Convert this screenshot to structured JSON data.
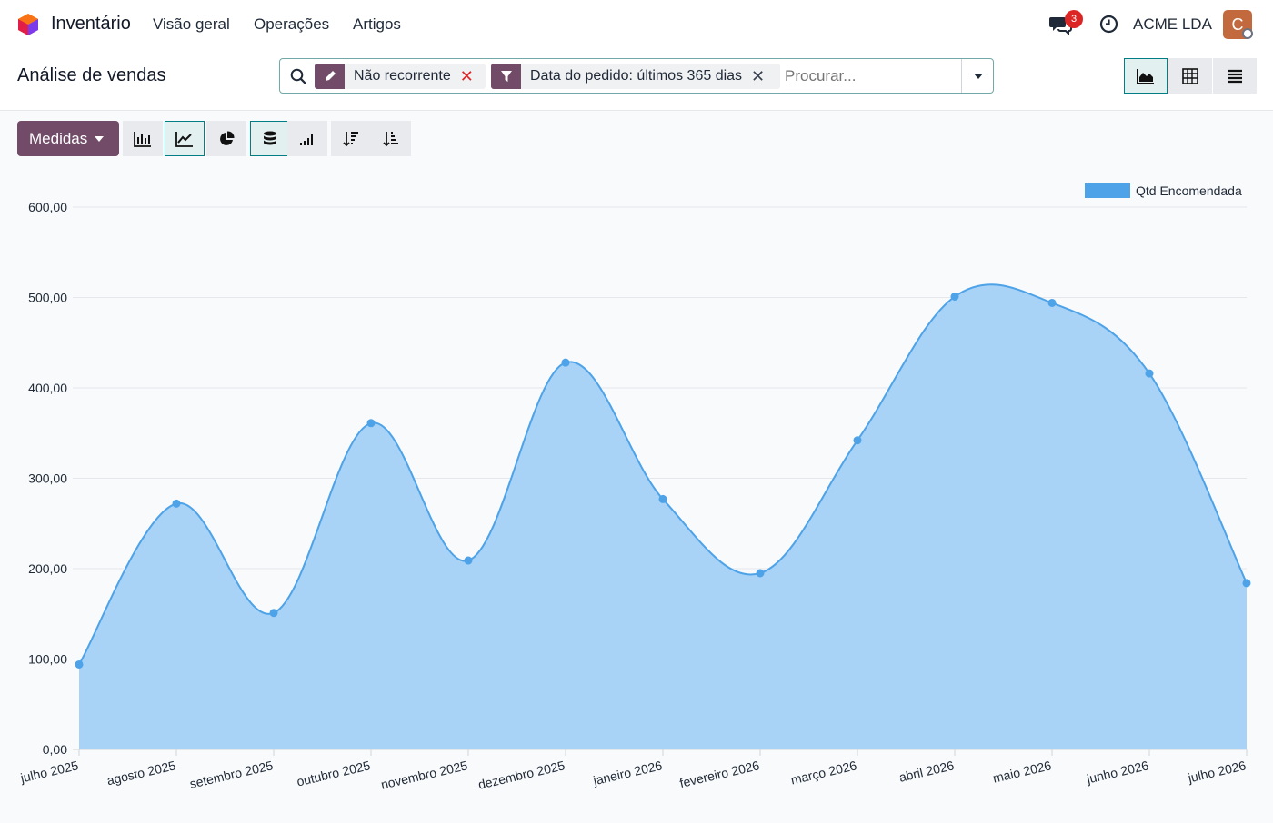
{
  "app": {
    "name": "Inventário",
    "menu": [
      "Visão geral",
      "Operações",
      "Artigos"
    ],
    "notifications_count": "3",
    "company": "ACME LDA",
    "avatar_letter": "C"
  },
  "control": {
    "page_title": "Análise de vendas",
    "facets": [
      {
        "label": "Não recorrente",
        "icon": "pencil-icon"
      },
      {
        "label": "Data do pedido: últimos 365 dias",
        "icon": "filter-icon"
      }
    ],
    "search_placeholder": "Procurar...",
    "views": [
      "graph-view-icon",
      "pivot-view-icon",
      "list-view-icon"
    ]
  },
  "toolbar": {
    "measures_label": "Medidas",
    "buttons": [
      "bar-chart-icon",
      "line-chart-icon",
      "pie-chart-icon",
      "stacked-icon",
      "cumulative-icon",
      "sort-descending-icon",
      "sort-ascending-icon"
    ]
  },
  "colors": {
    "brand": "#714b67",
    "accent": "#017e84",
    "series": "#4ea3e8",
    "series_fill": "#a8d2f6",
    "close_red": "#dc2626"
  },
  "chart_data": {
    "type": "area",
    "categories": [
      "julho 2025",
      "agosto 2025",
      "setembro 2025",
      "outubro 2025",
      "novembro 2025",
      "dezembro 2025",
      "janeiro 2026",
      "fevereiro 2026",
      "março 2026",
      "abril 2026",
      "maio 2026",
      "junho 2026",
      "julho 2026"
    ],
    "series": [
      {
        "name": "Qtd Encomendada",
        "values": [
          94,
          272,
          151,
          361,
          209,
          428,
          277,
          195,
          342,
          501,
          494,
          416,
          184
        ]
      }
    ],
    "ylim": [
      0,
      600
    ],
    "yticks": [
      "0,00",
      "100,00",
      "200,00",
      "300,00",
      "400,00",
      "500,00",
      "600,00"
    ],
    "grid": true,
    "legend": "top-right"
  }
}
